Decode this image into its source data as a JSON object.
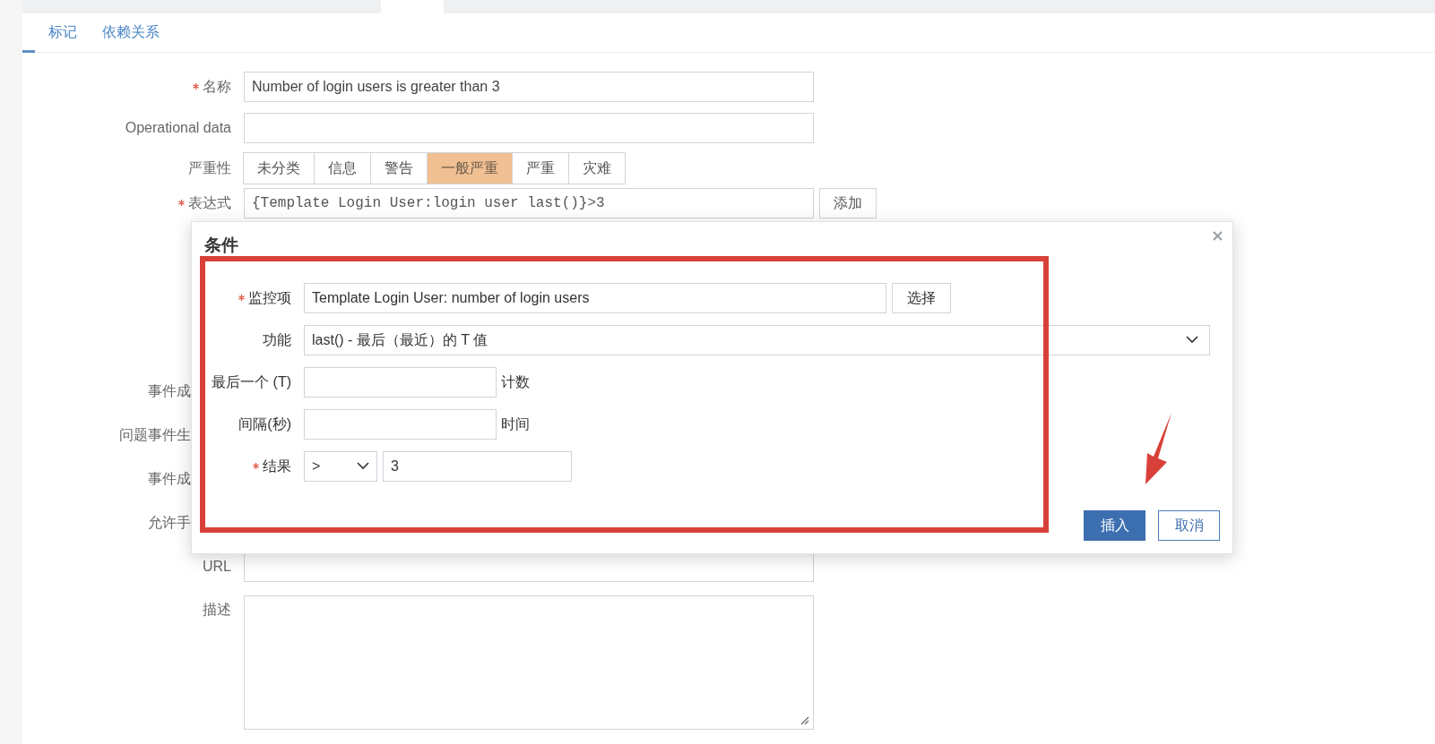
{
  "tabs": [
    {
      "label": "标记",
      "selected": false
    },
    {
      "label": "依赖关系",
      "selected": false
    }
  ],
  "form": [
    {
      "kind": "text",
      "label": "名称",
      "required": true,
      "value": "Number of login users is greater than 3"
    },
    {
      "kind": "text",
      "label": "Operational data",
      "required": false
    },
    {
      "kind": "segments",
      "label": "严重性",
      "required": false,
      "options": [
        {
          "label": "未分类",
          "selected": false
        },
        {
          "label": "信息",
          "selected": false
        },
        {
          "label": "警告",
          "selected": false
        },
        {
          "label": "一般严重",
          "selected": true
        },
        {
          "label": "严重",
          "selected": false
        },
        {
          "label": "灾难",
          "selected": false
        }
      ]
    },
    {
      "kind": "expression",
      "label": "表达式",
      "required": true,
      "value": "{Template Login User:login user last()}>3",
      "button": "添加"
    },
    {
      "kind": "covered",
      "label": "事件成"
    },
    {
      "kind": "covered",
      "label": "问题事件生"
    },
    {
      "kind": "covered",
      "label": "事件成"
    },
    {
      "kind": "covered",
      "label": "允许手"
    },
    {
      "kind": "text",
      "label": "URL",
      "required": false
    },
    {
      "kind": "textarea",
      "label": "描述",
      "required": false
    }
  ],
  "dialog": {
    "title": "条件",
    "rows": [
      {
        "kind": "picker",
        "label": "监控项",
        "required": true,
        "value": "Template Login User: number of login users",
        "button": "选择"
      },
      {
        "kind": "select",
        "label": "功能",
        "required": false,
        "value": "last() - 最后（最近）的 T 值"
      },
      {
        "kind": "suffix",
        "label": "最后一个 (T)",
        "required": false,
        "suffix": "计数"
      },
      {
        "kind": "suffix",
        "label": "间隔(秒)",
        "required": false,
        "suffix": "时间"
      },
      {
        "kind": "compare",
        "label": "结果",
        "required": true,
        "operator": ">",
        "value": "3"
      }
    ],
    "buttons": [
      {
        "label": "插入",
        "primary": true
      },
      {
        "label": "取消",
        "primary": false
      }
    ]
  }
}
